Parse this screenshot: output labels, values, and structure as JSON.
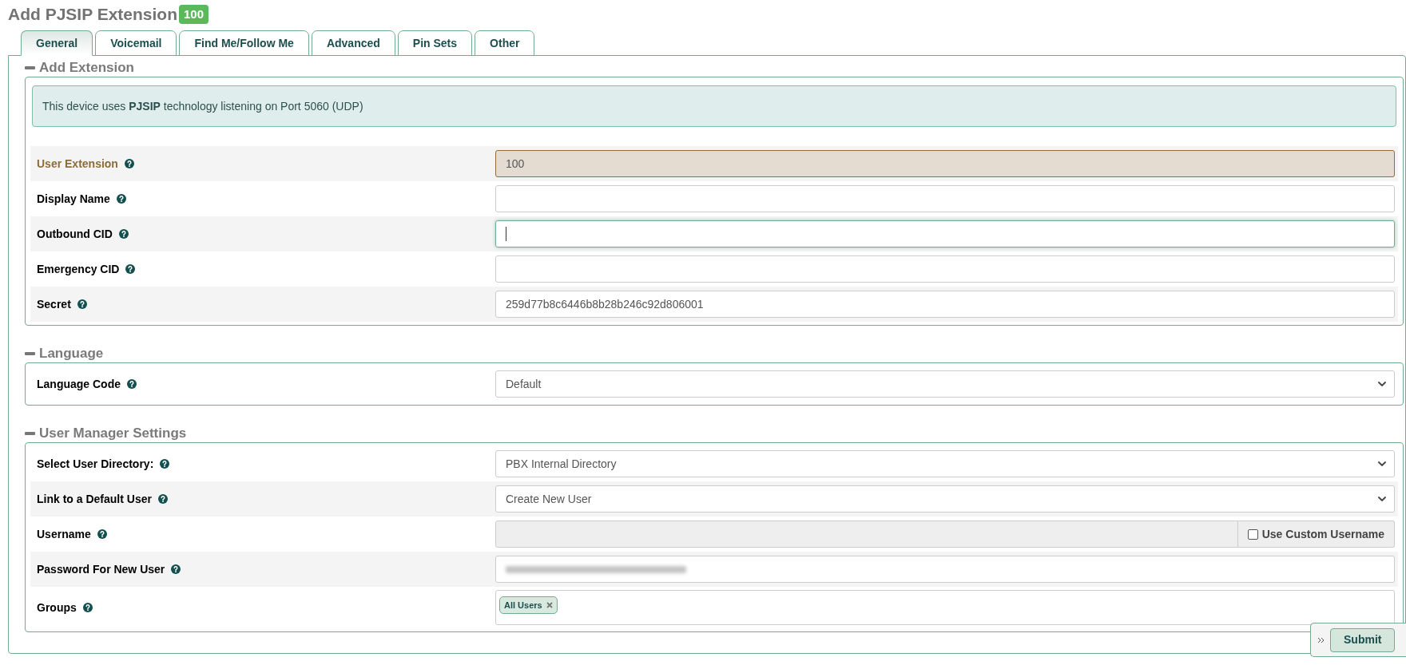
{
  "page": {
    "title": "Add PJSIP Extension",
    "badge": "100"
  },
  "tabs": [
    {
      "label": "General",
      "selected": true
    },
    {
      "label": "Voicemail",
      "selected": false
    },
    {
      "label": "Find Me/Follow Me",
      "selected": false
    },
    {
      "label": "Advanced",
      "selected": false
    },
    {
      "label": "Pin Sets",
      "selected": false
    },
    {
      "label": "Other",
      "selected": false
    }
  ],
  "sections": [
    {
      "title": "Add Extension",
      "expanded": true,
      "notice": "This device uses **PJSIP** technology listening on Port 5060 (UDP)",
      "rows": [
        {
          "kind": "text",
          "label": "User Extension",
          "value": "100",
          "readonly": true,
          "focused": false,
          "disabled": false
        },
        {
          "kind": "text",
          "label": "Display Name",
          "readonly": false,
          "focused": false,
          "disabled": false
        },
        {
          "kind": "text",
          "label": "Outbound CID",
          "readonly": false,
          "focused": true,
          "disabled": false
        },
        {
          "kind": "text",
          "label": "Emergency CID",
          "readonly": false,
          "focused": false,
          "disabled": false
        },
        {
          "kind": "text",
          "label": "Secret",
          "value": "259d77b8c6446b8b28b246c92d806001",
          "readonly": false,
          "focused": false,
          "disabled": false
        }
      ]
    },
    {
      "title": "Language",
      "expanded": true,
      "rows": [
        {
          "kind": "select",
          "label": "Language Code",
          "value": "Default",
          "readonly": false,
          "focused": false,
          "disabled": false
        }
      ]
    },
    {
      "title": "User Manager Settings",
      "expanded": true,
      "rows": [
        {
          "kind": "select",
          "label": "Select User Directory:",
          "value": "PBX Internal Directory",
          "readonly": false,
          "focused": false,
          "disabled": false
        },
        {
          "kind": "select",
          "label": "Link to a Default User",
          "value": "Create New User",
          "readonly": false,
          "focused": false,
          "disabled": false
        },
        {
          "kind": "text",
          "label": "Username",
          "readonly": false,
          "focused": false,
          "disabled": true,
          "addon": {
            "label": "Use Custom Username",
            "checked": false
          }
        },
        {
          "kind": "redacted",
          "label": "Password For New User",
          "readonly": false,
          "focused": false,
          "disabled": false
        },
        {
          "kind": "tags",
          "label": "Groups",
          "tags": [
            "All Users"
          ],
          "readonly": false,
          "focused": false,
          "disabled": false
        }
      ]
    }
  ],
  "actions": {
    "buttons": [
      "Submit"
    ]
  }
}
